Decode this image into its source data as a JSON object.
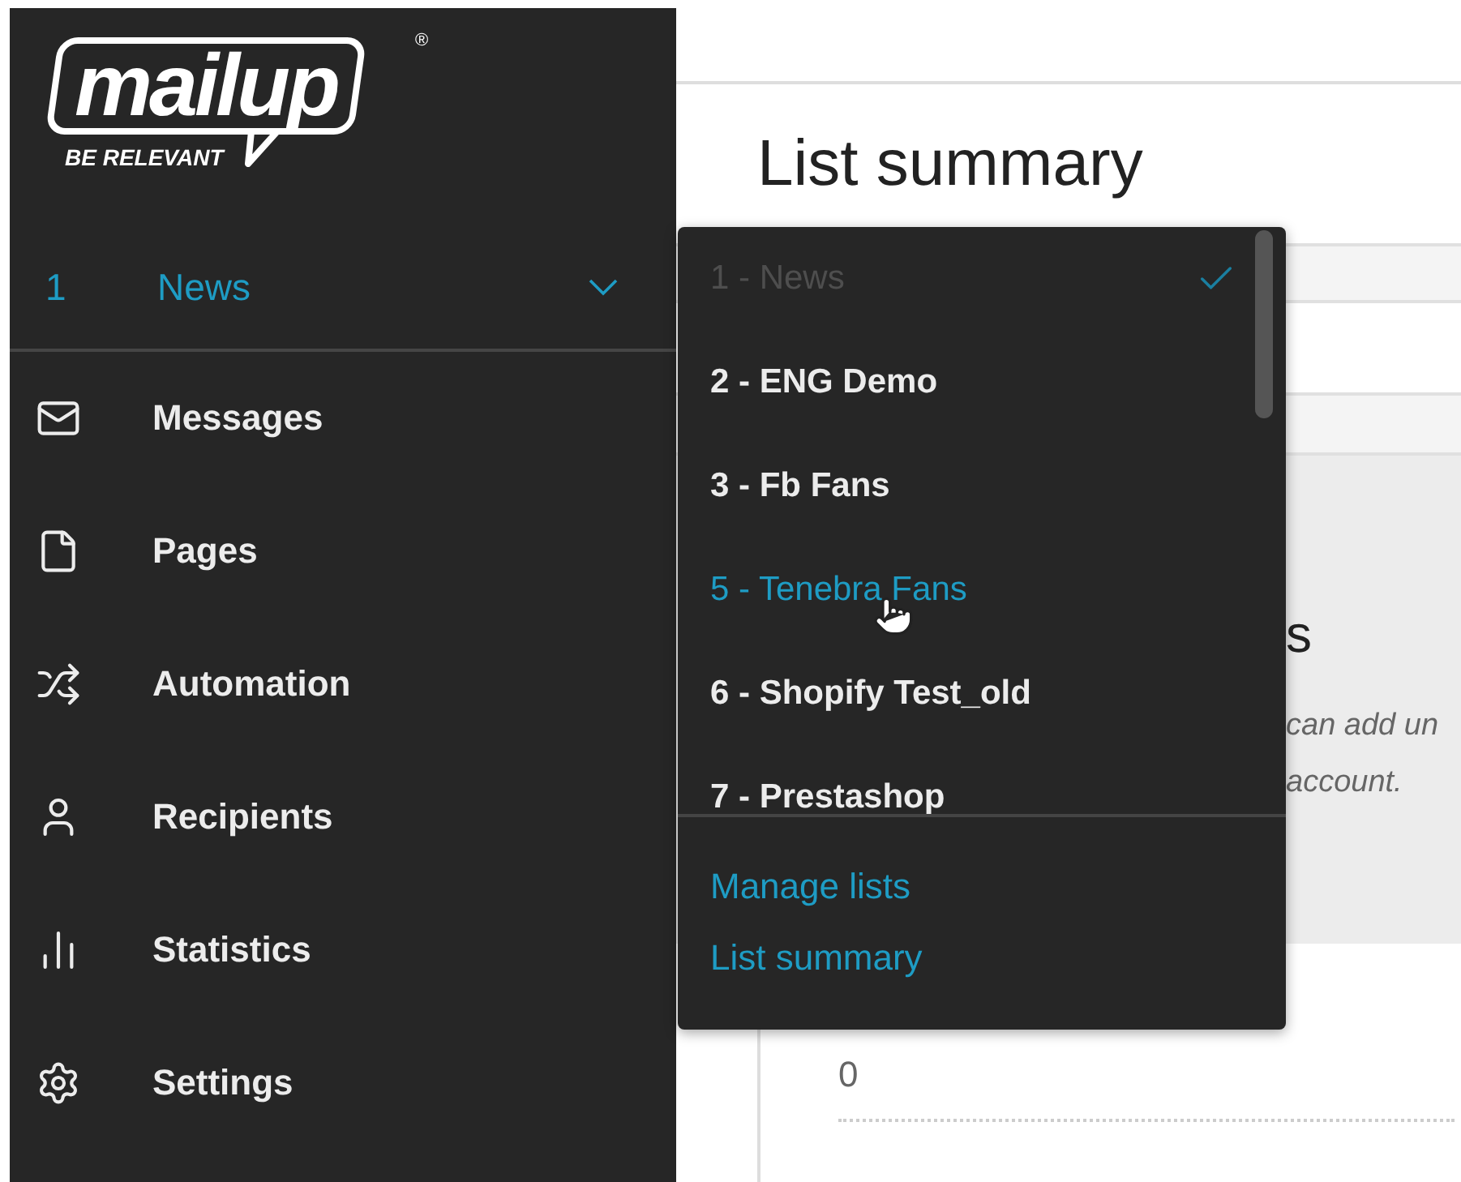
{
  "logo": {
    "wordmark": "mailup",
    "tagline": "BE RELEVANT",
    "mark": "®"
  },
  "list_selector": {
    "number": "1",
    "name": "News",
    "expanded": true
  },
  "nav": [
    {
      "label": "Messages"
    },
    {
      "label": "Pages"
    },
    {
      "label": "Automation"
    },
    {
      "label": "Recipients"
    },
    {
      "label": "Statistics"
    },
    {
      "label": "Settings"
    }
  ],
  "page": {
    "title": "List summary",
    "panel_heading": "s",
    "panel_lines": [
      "can add un",
      "account."
    ],
    "card_value": "0"
  },
  "dropdown": {
    "items": [
      {
        "label": "1 - News",
        "selected": true,
        "disabled": true,
        "hovered": false
      },
      {
        "label": "2 - ENG Demo",
        "selected": false,
        "disabled": false,
        "hovered": false
      },
      {
        "label": "3 - Fb Fans",
        "selected": false,
        "disabled": false,
        "hovered": false
      },
      {
        "label": "5 - Tenebra Fans",
        "selected": false,
        "disabled": false,
        "hovered": true
      },
      {
        "label": "6 - Shopify Test_old",
        "selected": false,
        "disabled": false,
        "hovered": false
      },
      {
        "label": "7 - Prestashop",
        "selected": false,
        "disabled": false,
        "hovered": false
      }
    ],
    "links": [
      "Manage lists",
      "List summary"
    ]
  }
}
